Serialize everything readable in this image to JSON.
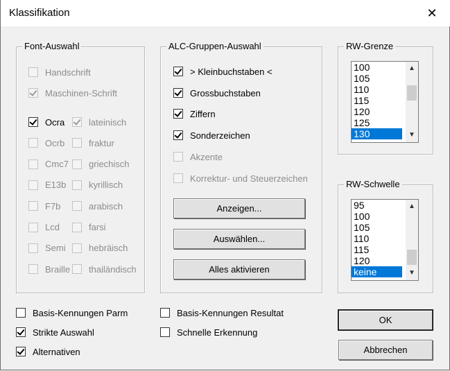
{
  "window": {
    "title": "Klassifikation",
    "close_glyph": "✕"
  },
  "font_group": {
    "legend": "Font-Auswahl",
    "items": [
      {
        "label": "Handschrift",
        "checked": false,
        "disabled": true
      },
      {
        "label": "Maschinen-Schrift",
        "checked": true,
        "disabled": true
      },
      {
        "label": "Ocra",
        "checked": true,
        "disabled": false
      },
      {
        "label": "lateinisch",
        "checked": true,
        "disabled": true
      },
      {
        "label": "Ocrb",
        "checked": false,
        "disabled": true
      },
      {
        "label": "fraktur",
        "checked": false,
        "disabled": true
      },
      {
        "label": "Cmc7",
        "checked": false,
        "disabled": true
      },
      {
        "label": "griechisch",
        "checked": false,
        "disabled": true
      },
      {
        "label": "E13b",
        "checked": false,
        "disabled": true
      },
      {
        "label": "kyrillisch",
        "checked": false,
        "disabled": true
      },
      {
        "label": "F7b",
        "checked": false,
        "disabled": true
      },
      {
        "label": "arabisch",
        "checked": false,
        "disabled": true
      },
      {
        "label": "Lcd",
        "checked": false,
        "disabled": true
      },
      {
        "label": "farsi",
        "checked": false,
        "disabled": true
      },
      {
        "label": "Semi",
        "checked": false,
        "disabled": true
      },
      {
        "label": "hebräisch",
        "checked": false,
        "disabled": true
      },
      {
        "label": "Braille",
        "checked": false,
        "disabled": true
      },
      {
        "label": "thailändisch",
        "checked": false,
        "disabled": true
      }
    ]
  },
  "alc_group": {
    "legend": "ALC-Gruppen-Auswahl",
    "items": [
      {
        "label": "> Kleinbuchstaben <",
        "checked": true,
        "disabled": false
      },
      {
        "label": "Grossbuchstaben",
        "checked": true,
        "disabled": false
      },
      {
        "label": "Ziffern",
        "checked": true,
        "disabled": false
      },
      {
        "label": "Sonderzeichen",
        "checked": true,
        "disabled": false
      },
      {
        "label": "Akzente",
        "checked": false,
        "disabled": true
      },
      {
        "label": "Korrektur- und Steuerzeichen",
        "checked": false,
        "disabled": true
      }
    ],
    "buttons": {
      "show": "Anzeigen...",
      "select": "Auswählen...",
      "activate_all": "Alles aktivieren"
    }
  },
  "rw_grenze": {
    "legend": "RW-Grenze",
    "items": [
      "100",
      "105",
      "110",
      "115",
      "120",
      "125",
      "130"
    ],
    "selected": "130"
  },
  "rw_schwelle": {
    "legend": "RW-Schwelle",
    "items": [
      "95",
      "100",
      "105",
      "110",
      "115",
      "120",
      "keine"
    ],
    "selected": "keine"
  },
  "options": [
    {
      "label": "Basis-Kennungen Parm",
      "checked": false
    },
    {
      "label": "Strikte Auswahl",
      "checked": true
    },
    {
      "label": "Alternativen",
      "checked": true
    },
    {
      "label": "Basis-Kennungen Resultat",
      "checked": false
    },
    {
      "label": "Schnelle Erkennung",
      "checked": false
    }
  ],
  "dialog_buttons": {
    "ok": "OK",
    "cancel": "Abbrechen"
  },
  "icons": {
    "scroll_up": "up-arrow-icon",
    "scroll_down": "down-arrow-icon"
  }
}
